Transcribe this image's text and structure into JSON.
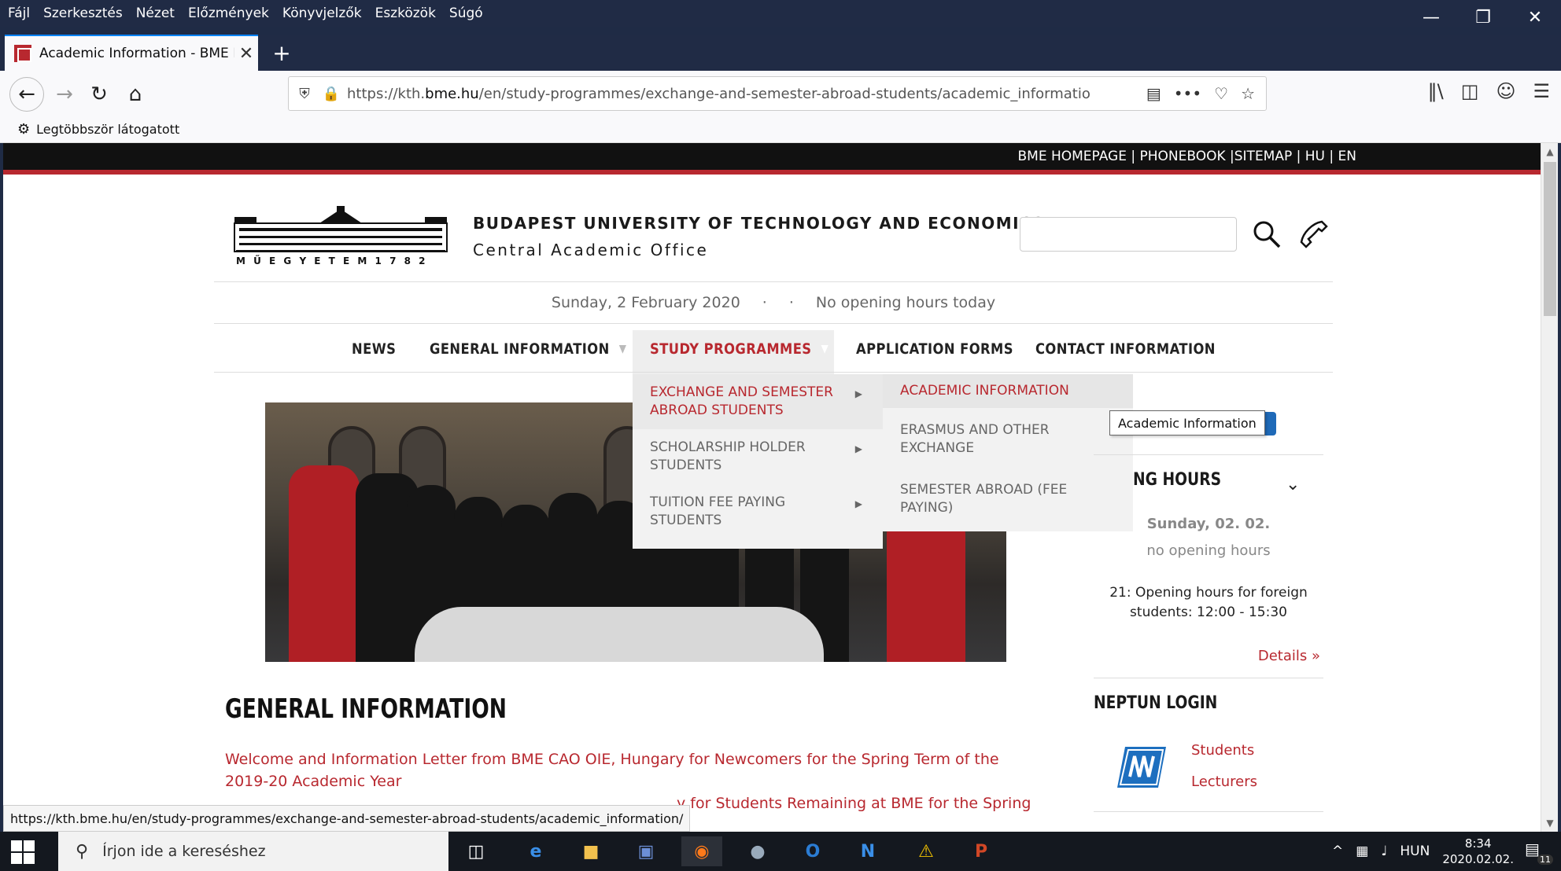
{
  "firefox": {
    "menu": [
      "Fájl",
      "Szerkesztés",
      "Nézet",
      "Előzmények",
      "Könyvjelzők",
      "Eszközök",
      "Súgó"
    ],
    "tab_title": "Academic Information - BME K",
    "url_prefix": "https://kth.",
    "url_domain": "bme.hu",
    "url_rest": "/en/study-programmes/exchange-and-semester-abroad-students/academic_informatio",
    "bookmark": "Legtöbbször látogatott",
    "status_url": "https://kth.bme.hu/en/study-programmes/exchange-and-semester-abroad-students/academic_information/"
  },
  "site": {
    "topbar": "BME HOMEPAGE | PHONEBOOK |SITEMAP | HU | EN",
    "logo_text": "M Ű E G Y E T E M   1 7 8 2",
    "university": "BUDAPEST UNIVERSITY OF TECHNOLOGY AND ECONOMICS",
    "office": "Central Academic Office",
    "date": "Sunday, 2 February 2020",
    "sep1": "·",
    "sep2": "·",
    "opening": "No opening hours today",
    "nav": {
      "news": "NEWS",
      "general": "GENERAL INFORMATION",
      "study": "STUDY PROGRAMMES",
      "forms": "APPLICATION FORMS",
      "contact": "CONTACT INFORMATION"
    },
    "dropdown1": [
      "EXCHANGE AND SEMESTER ABROAD STUDENTS",
      "SCHOLARSHIP HOLDER STUDENTS",
      "TUITION FEE PAYING STUDENTS"
    ],
    "dropdown2": [
      "ACADEMIC INFORMATION",
      "ERASMUS AND OTHER EXCHANGE",
      "SEMESTER ABROAD (FEE PAYING)"
    ],
    "tooltip": "Academic Information",
    "sidebar": {
      "opening_title": "NG HOURS",
      "day": "Sunday, 02. 02.",
      "none": "no opening hours",
      "foreign": "21: Opening hours for foreign students: 12:00 - 15:30",
      "details": "Details »",
      "neptun_title": "NEPTUN LOGIN",
      "students": "Students",
      "lecturers": "Lecturers"
    },
    "general_title": "GENERAL INFORMATION",
    "welcome": "Welcome and Information Letter from BME CAO OIE, Hungary for Newcomers for the Spring Term of the 2019-20 Academic Year",
    "remaining": "y for Students Remaining at BME for the Spring"
  },
  "taskbar": {
    "search_placeholder": "Írjon ide a kereséshez",
    "lang": "HUN",
    "time": "8:34",
    "date": "2020.02.02.",
    "notif_count": "11"
  },
  "colors": {
    "accent": "#b8282f",
    "chrome": "#202b45"
  }
}
